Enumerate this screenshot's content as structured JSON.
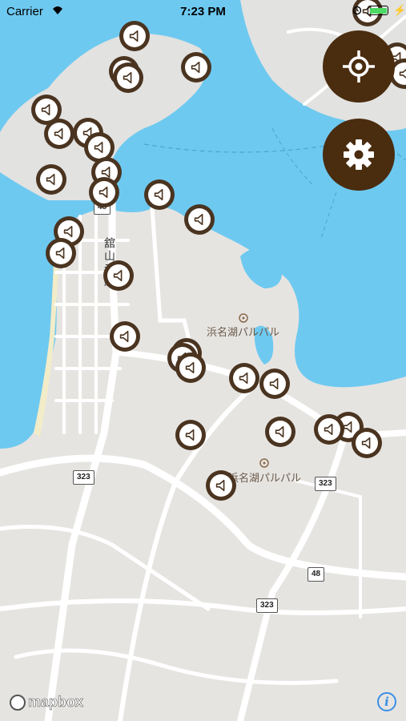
{
  "status_bar": {
    "carrier": "Carrier",
    "time": "7:23 PM"
  },
  "map": {
    "place_labels": [
      "浜名湖パルパル",
      "浜名湖パルパル"
    ],
    "road_vertical_label": "舘山寺線",
    "route_shields": [
      "323",
      "323",
      "48",
      "323",
      "48"
    ]
  },
  "markers": {
    "icon": "speaker-icon",
    "count": 33
  },
  "controls": {
    "locate_icon": "crosshair-icon",
    "settings_icon": "gear-icon"
  },
  "attribution": {
    "logo_text": "mapbox",
    "info_label": "i"
  },
  "colors": {
    "water": "#6ec9f0",
    "land": "#e6e4e1",
    "marker": "#4a3420",
    "fab": "#4a2c0f",
    "info": "#3a8ee6"
  }
}
